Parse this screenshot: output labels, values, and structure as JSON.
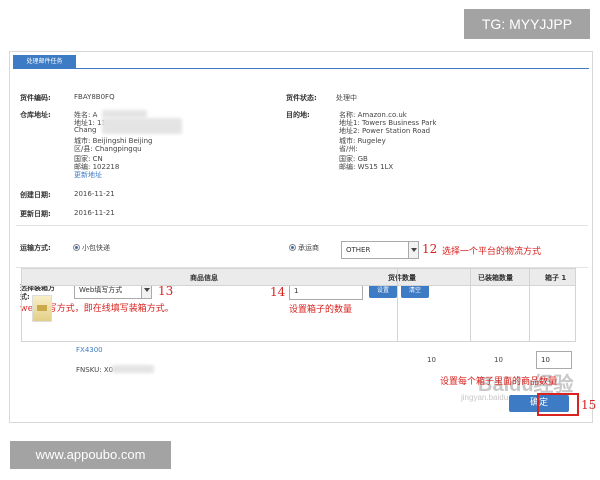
{
  "watermarks": {
    "top": "TG: MYYJJPP",
    "bottom": "www.appoubo.com"
  },
  "tab": {
    "label": "处理邮件任务"
  },
  "details": {
    "task_id_label": "货件编码:",
    "task_id_value": "FBAY8B0FQ",
    "status_label": "货件状态:",
    "status_value": "处理中",
    "warehouse_label": "仓库地址:",
    "warehouse_lines": [
      "姓名: A",
      "地址1: 11",
      "Chang",
      "城市: Beijingshi Beijing",
      "区/县: Changpingqu",
      "国家: CN",
      "邮编: 102218"
    ],
    "warehouse_link": "更新地址",
    "dest_label": "目的地:",
    "dest_lines": [
      "名称: Amazon.co.uk",
      "地址1: Towers Business Park",
      "地址2: Power Station Road",
      "城市: Rugeley",
      "省/州:",
      "国家: GB",
      "邮编: WS15 1LX"
    ],
    "created_label": "创建日期:",
    "created_value": "2016-11-21",
    "updated_label": "更新日期:",
    "updated_value": "2016-11-21"
  },
  "shipping": {
    "label": "运输方式:",
    "option_small": "小包快递",
    "option_carrier": "承运商",
    "carrier_selected": "OTHER",
    "annotation_num": "12",
    "annotation_text": "选择一个平台的物流方式"
  },
  "packing": {
    "label_line1": "选择装箱方",
    "label_line2": "式:",
    "method_selected": "Web填写方式",
    "annotation_num": "13",
    "annotation_text": "web填写方式，即在线填写装箱方式。",
    "box_count_num": "14",
    "box_count_value": "1",
    "set_button": "设置",
    "clear_button": "清空",
    "box_count_note": "设置箱子的数量"
  },
  "table": {
    "headers": [
      "商品信息",
      "货件数量",
      "已装箱数量",
      "箱子 1"
    ],
    "rows": [
      {
        "sku": "FX4300",
        "fnsku_label": "FNSKU: X0",
        "qty": "10",
        "packed": "10",
        "box1": "10"
      }
    ]
  },
  "footer": {
    "note": "设置每个箱子里面的商品数量",
    "confirm_label": "确定",
    "annotation_num": "15",
    "ghost_text": "Baidu经验",
    "ghost_sub": "jingyan.baidu.com"
  },
  "colors": {
    "accent": "#3d7bc4",
    "annotation": "#d8231f"
  }
}
